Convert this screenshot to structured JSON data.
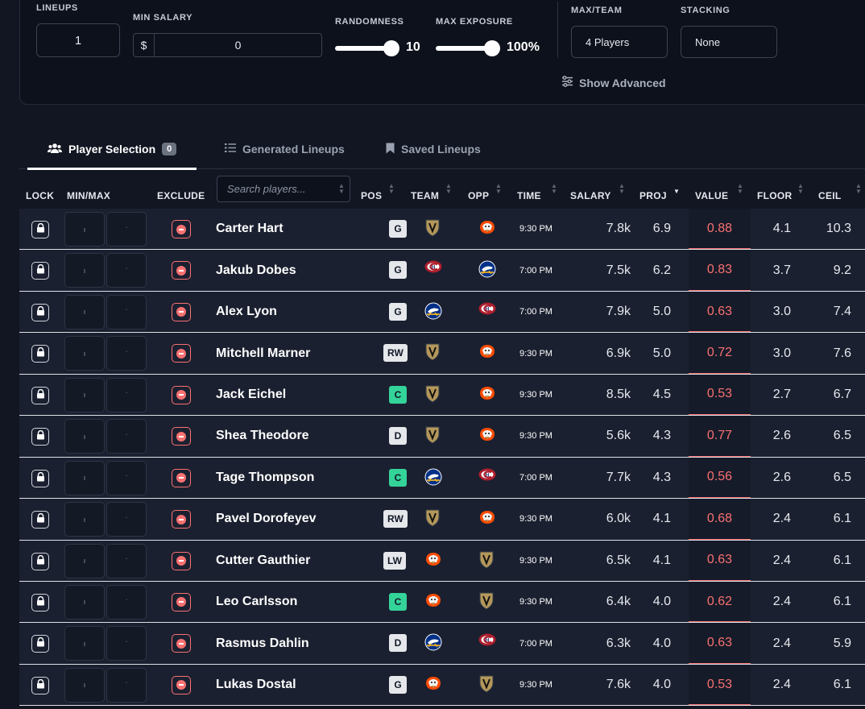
{
  "settings": {
    "lineups_label": "LINEUPS",
    "lineups_value": "1",
    "min_salary_label": "MIN SALARY",
    "salary_prefix": "$",
    "min_salary_value": "0",
    "randomness_label": "RANDOMNESS",
    "randomness_value": "10",
    "max_exposure_label": "MAX EXPOSURE",
    "max_exposure_value": "100%",
    "max_team_label": "MAX/TEAM",
    "max_team_value": "4 Players",
    "stacking_label": "STACKING",
    "stacking_value": "None",
    "show_advanced": "Show Advanced"
  },
  "tabs": [
    {
      "label": "Player Selection",
      "badge": "0",
      "active": true
    },
    {
      "label": "Generated Lineups"
    },
    {
      "label": "Saved Lineups"
    }
  ],
  "table": {
    "headers": {
      "lock": "LOCK",
      "minmax": "MIN/MAX",
      "exclude": "EXCLUDE",
      "pos": "POS",
      "team": "TEAM",
      "opp": "OPP",
      "time": "TIME",
      "salary": "SALARY",
      "proj": "PROJ",
      "value": "VALUE",
      "floor": "FLOOR",
      "ceil": "CEIL"
    },
    "search_placeholder": "Search players...",
    "rows": [
      {
        "name": "Carter Hart",
        "pos": "G",
        "team": "VGK",
        "opp": "ANA",
        "time": "9:30 PM",
        "salary": "7.8k",
        "proj": "6.9",
        "value": "0.88",
        "floor": "4.1",
        "ceil": "10.3"
      },
      {
        "name": "Jakub Dobes",
        "pos": "G",
        "team": "MTL",
        "opp": "BUF",
        "time": "7:00 PM",
        "salary": "7.5k",
        "proj": "6.2",
        "value": "0.83",
        "floor": "3.7",
        "ceil": "9.2"
      },
      {
        "name": "Alex Lyon",
        "pos": "G",
        "team": "BUF",
        "opp": "MTL",
        "time": "7:00 PM",
        "salary": "7.9k",
        "proj": "5.0",
        "value": "0.63",
        "floor": "3.0",
        "ceil": "7.4"
      },
      {
        "name": "Mitchell Marner",
        "pos": "RW",
        "team": "VGK",
        "opp": "ANA",
        "time": "9:30 PM",
        "salary": "6.9k",
        "proj": "5.0",
        "value": "0.72",
        "floor": "3.0",
        "ceil": "7.6"
      },
      {
        "name": "Jack Eichel",
        "pos": "C",
        "team": "VGK",
        "opp": "ANA",
        "time": "9:30 PM",
        "salary": "8.5k",
        "proj": "4.5",
        "value": "0.53",
        "floor": "2.7",
        "ceil": "6.7"
      },
      {
        "name": "Shea Theodore",
        "pos": "D",
        "team": "VGK",
        "opp": "ANA",
        "time": "9:30 PM",
        "salary": "5.6k",
        "proj": "4.3",
        "value": "0.77",
        "floor": "2.6",
        "ceil": "6.5"
      },
      {
        "name": "Tage Thompson",
        "pos": "C",
        "team": "BUF",
        "opp": "MTL",
        "time": "7:00 PM",
        "salary": "7.7k",
        "proj": "4.3",
        "value": "0.56",
        "floor": "2.6",
        "ceil": "6.5"
      },
      {
        "name": "Pavel Dorofeyev",
        "pos": "RW",
        "team": "VGK",
        "opp": "ANA",
        "time": "9:30 PM",
        "salary": "6.0k",
        "proj": "4.1",
        "value": "0.68",
        "floor": "2.4",
        "ceil": "6.1"
      },
      {
        "name": "Cutter Gauthier",
        "pos": "LW",
        "team": "ANA",
        "opp": "VGK",
        "time": "9:30 PM",
        "salary": "6.5k",
        "proj": "4.1",
        "value": "0.63",
        "floor": "2.4",
        "ceil": "6.1"
      },
      {
        "name": "Leo Carlsson",
        "pos": "C",
        "team": "ANA",
        "opp": "VGK",
        "time": "9:30 PM",
        "salary": "6.4k",
        "proj": "4.0",
        "value": "0.62",
        "floor": "2.4",
        "ceil": "6.1"
      },
      {
        "name": "Rasmus Dahlin",
        "pos": "D",
        "team": "BUF",
        "opp": "MTL",
        "time": "7:00 PM",
        "salary": "6.3k",
        "proj": "4.0",
        "value": "0.63",
        "floor": "2.4",
        "ceil": "5.9"
      },
      {
        "name": "Lukas Dostal",
        "pos": "G",
        "team": "ANA",
        "opp": "VGK",
        "time": "9:30 PM",
        "salary": "7.6k",
        "proj": "4.0",
        "value": "0.53",
        "floor": "2.4",
        "ceil": "6.1"
      }
    ]
  },
  "colors": {
    "background": "#121622",
    "row": "#1b2030",
    "value_text": "#f87171",
    "badge_c": "#34d399",
    "badge_default": "#e5e7eb"
  }
}
